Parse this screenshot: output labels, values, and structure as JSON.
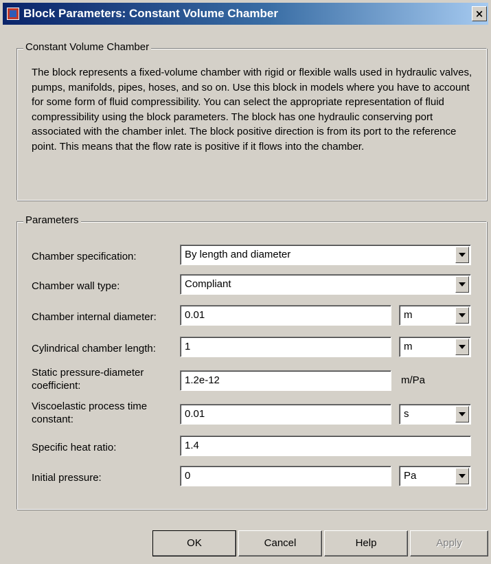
{
  "window": {
    "title": "Block Parameters: Constant Volume Chamber",
    "close_label": "×"
  },
  "description_group": {
    "legend": "Constant Volume Chamber",
    "text": "The block represents a fixed-volume chamber with rigid or flexible walls used in hydraulic valves, pumps, manifolds, pipes, hoses, and so on. Use this block in models where you have to account for some form of fluid compressibility. You can select the appropriate representation of fluid compressibility using the block parameters. The block has one hydraulic conserving port associated with the chamber inlet. The block positive direction is from its port to the reference point. This means that the flow rate is positive if it flows into the chamber."
  },
  "parameters": {
    "legend": "Parameters",
    "chamber_specification": {
      "label": "Chamber specification:",
      "value": "By length and diameter"
    },
    "chamber_wall_type": {
      "label": "Chamber wall type:",
      "value": "Compliant"
    },
    "internal_diameter": {
      "label": "Chamber internal diameter:",
      "value": "0.01",
      "unit": "m"
    },
    "chamber_length": {
      "label": "Cylindrical chamber length:",
      "value": "1",
      "unit": "m"
    },
    "pressure_diameter_coeff": {
      "label": "Static pressure-diameter coefficient:",
      "value": "1.2e-12",
      "unit": "m/Pa"
    },
    "time_constant": {
      "label": "Viscoelastic process time constant:",
      "value": "0.01",
      "unit": "s"
    },
    "specific_heat_ratio": {
      "label": "Specific heat ratio:",
      "value": "1.4"
    },
    "initial_pressure": {
      "label": "Initial pressure:",
      "value": "0",
      "unit": "Pa"
    }
  },
  "buttons": {
    "ok": "OK",
    "cancel": "Cancel",
    "help": "Help",
    "apply": "Apply"
  }
}
